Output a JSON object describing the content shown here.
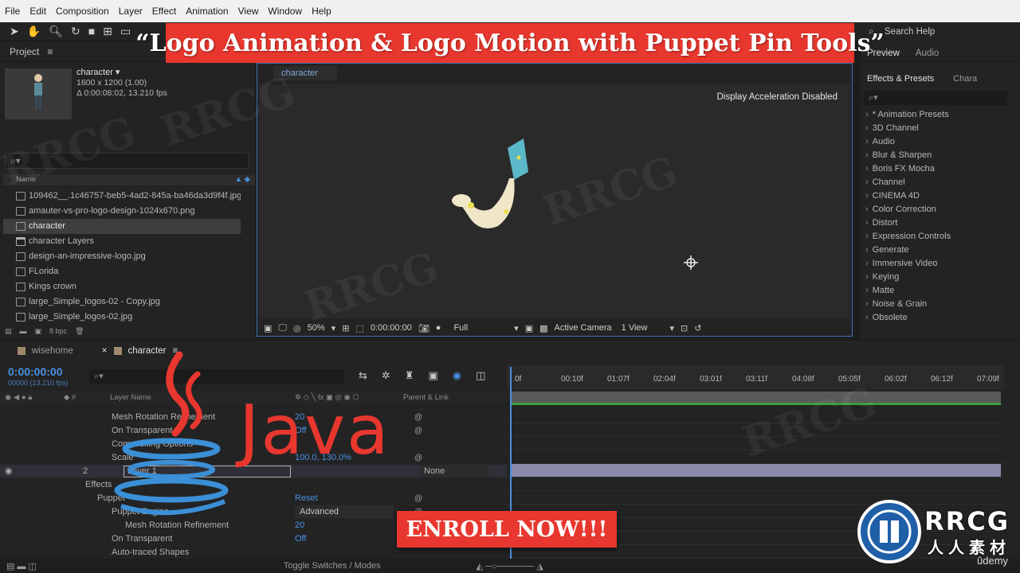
{
  "menu": [
    "File",
    "Edit",
    "Composition",
    "Layer",
    "Effect",
    "Animation",
    "View",
    "Window",
    "Help"
  ],
  "banner_title": "“Logo Animation & Logo Motion with Puppet Pin Tools”",
  "project": {
    "tab_label": "Project",
    "comp_name": "character",
    "comp_dims": "1600 x 1200 (1.00)",
    "comp_duration": "Δ 0:00:08:02, 13.210 fps",
    "column_name": "Name",
    "depth": "8 bpc",
    "files": [
      {
        "name": "109462__.1c46757-beb5-4ad2-845a-ba46da3d9f4f.jpg",
        "type": "image"
      },
      {
        "name": "amauter-vs-pro-logo-design-1024x670.png",
        "type": "image"
      },
      {
        "name": "character",
        "type": "comp"
      },
      {
        "name": "character Layers",
        "type": "folder"
      },
      {
        "name": "design-an-impressive-logo.jpg",
        "type": "image"
      },
      {
        "name": "FLorida",
        "type": "comp"
      },
      {
        "name": "Kings crown",
        "type": "comp"
      },
      {
        "name": "large_Simple_logos-02 - Copy.jpg",
        "type": "image"
      },
      {
        "name": "large_Simple_logos-02.jpg",
        "type": "image"
      }
    ]
  },
  "composition": {
    "tab_label": "character",
    "accel_message": "Display Acceleration Disabled",
    "zoom": "50%",
    "timecode": "0:00:00:00",
    "resolution": "Full",
    "camera": "Active Camera",
    "views": "1 View"
  },
  "right_panel": {
    "search_help": "Search Help",
    "tabs": [
      "Preview",
      "Audio"
    ],
    "effects_tabs": [
      "Effects & Presets",
      "Chara"
    ],
    "effects": [
      "* Animation Presets",
      "3D Channel",
      "Audio",
      "Blur & Sharpen",
      "Boris FX Mocha",
      "Channel",
      "CINEMA 4D",
      "Color Correction",
      "Distort",
      "Expression Controls",
      "Generate",
      "Immersive Video",
      "Keying",
      "Matte",
      "Noise & Grain",
      "Obsolete"
    ]
  },
  "timeline": {
    "tabs": [
      "wisehome",
      "character"
    ],
    "timecode": "0:00:00:00",
    "fps": "00000 (13.210 fps)",
    "col_layer_name": "Layer Name",
    "col_parent": "Parent & Link",
    "ruler_ticks": [
      "0f",
      "00:10f",
      "01:07f",
      "02:04f",
      "03:01f",
      "03:11f",
      "04:08f",
      "05:05f",
      "06:02f",
      "06:12f",
      "07:09f"
    ],
    "rows": [
      {
        "label": "Mesh Rotation Refinement",
        "value": "20",
        "indent": 140
      },
      {
        "label": "On Transparent",
        "value": "Off",
        "indent": 140
      },
      {
        "label": "Compositing Options",
        "value": "",
        "indent": 140
      },
      {
        "label": "Scale",
        "value": "100.0, 130.0%",
        "indent": 140
      },
      {
        "label": "Layer 1",
        "value": "",
        "indent": 155,
        "num": "2",
        "parent": "None"
      },
      {
        "label": "Effects",
        "value": "",
        "indent": 107
      },
      {
        "label": "Puppet",
        "value": "Reset",
        "indent": 122
      },
      {
        "label": "Puppet Engine",
        "value": "Advanced",
        "indent": 140
      },
      {
        "label": "Mesh Rotation Refinement",
        "value": "20",
        "indent": 157
      },
      {
        "label": "On Transparent",
        "value": "Off",
        "indent": 140
      },
      {
        "label": "Auto-traced Shapes",
        "value": "",
        "indent": 140
      }
    ],
    "footer": "Toggle Switches / Modes"
  },
  "overlays": {
    "enroll": "ENROLL NOW!!!",
    "java": "Java",
    "rrcg": "RRCG",
    "rrcg_sub": "人人素材",
    "udemy": "ûdemy",
    "watermark": "RRCG"
  }
}
